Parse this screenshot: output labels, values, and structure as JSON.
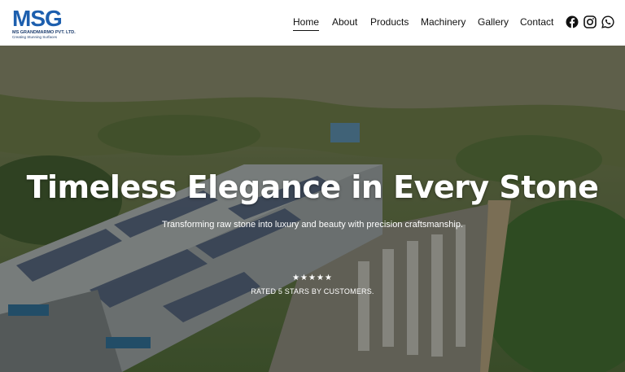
{
  "brand": {
    "logo_text": "MSG",
    "company_name": "MS GRANDMARMO PVT. LTD.",
    "tagline": "Creating Stunning Surfaces",
    "color": "#1d5fae"
  },
  "nav": {
    "items": [
      {
        "label": "Home",
        "active": true
      },
      {
        "label": "About",
        "active": false
      },
      {
        "label": "Products",
        "active": false
      },
      {
        "label": "Machinery",
        "active": false
      },
      {
        "label": "Gallery",
        "active": false
      },
      {
        "label": "Contact",
        "active": false
      }
    ]
  },
  "social": {
    "icons": [
      "facebook-icon",
      "instagram-icon",
      "whatsapp-icon"
    ]
  },
  "hero": {
    "title": "Timeless Elegance in Every Stone",
    "subtitle": "Transforming raw stone into luxury and beauty with precision craftsmanship.",
    "stars": "★★★★★",
    "rating_value": 5,
    "rating_text": "RATED 5 STARS BY CUSTOMERS."
  }
}
